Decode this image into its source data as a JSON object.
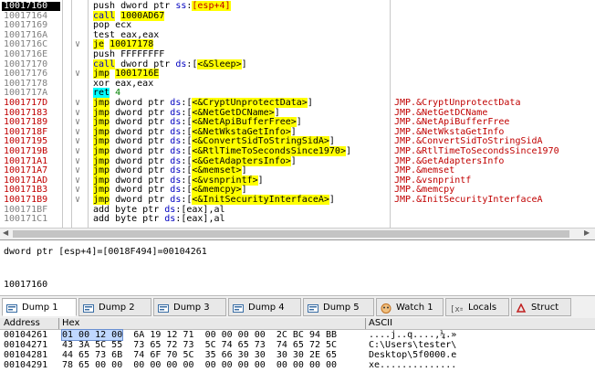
{
  "disasm": {
    "rows": [
      {
        "addr": "10017160",
        "addr_style": "sel",
        "arrow": "",
        "parts": [
          [
            "push dword ptr ",
            "n"
          ],
          [
            "ss",
            "b"
          ],
          [
            ":",
            "n"
          ],
          [
            "[esp+4]",
            "r"
          ]
        ],
        "comment": ""
      },
      {
        "addr": "10017164",
        "addr_style": "",
        "arrow": "",
        "parts": [
          [
            "call",
            "yb"
          ],
          [
            " ",
            "n"
          ],
          [
            "1000AD67",
            "y"
          ]
        ],
        "comment": ""
      },
      {
        "addr": "10017169",
        "addr_style": "",
        "arrow": "",
        "parts": [
          [
            "pop ecx",
            "n"
          ]
        ],
        "comment": ""
      },
      {
        "addr": "1001716A",
        "addr_style": "",
        "arrow": "",
        "parts": [
          [
            "test eax,eax",
            "n"
          ]
        ],
        "comment": ""
      },
      {
        "addr": "1001716C",
        "addr_style": "",
        "arrow": "∨",
        "parts": [
          [
            "je",
            "y"
          ],
          [
            " ",
            "n"
          ],
          [
            "10017178",
            "y"
          ]
        ],
        "comment": ""
      },
      {
        "addr": "1001716E",
        "addr_style": "",
        "arrow": "",
        "parts": [
          [
            "push FFFFFFFF",
            "n"
          ]
        ],
        "comment": ""
      },
      {
        "addr": "10017170",
        "addr_style": "",
        "arrow": "",
        "parts": [
          [
            "call",
            "yb"
          ],
          [
            " dword ptr ",
            "n"
          ],
          [
            "ds",
            "b"
          ],
          [
            ":[",
            "n"
          ],
          [
            "<&Sleep>",
            "y"
          ],
          [
            "]",
            "n"
          ]
        ],
        "comment": ""
      },
      {
        "addr": "10017176",
        "addr_style": "",
        "arrow": "∨",
        "parts": [
          [
            "jmp",
            "y"
          ],
          [
            " ",
            "n"
          ],
          [
            "1001716E",
            "y"
          ]
        ],
        "comment": ""
      },
      {
        "addr": "10017178",
        "addr_style": "",
        "arrow": "",
        "parts": [
          [
            "xor eax,eax",
            "n"
          ]
        ],
        "comment": ""
      },
      {
        "addr": "1001717A",
        "addr_style": "",
        "arrow": "",
        "parts": [
          [
            "ret",
            "c"
          ],
          [
            " 4",
            "g"
          ]
        ],
        "comment": ""
      },
      {
        "addr": "1001717D",
        "addr_style": "red",
        "arrow": "∨",
        "parts": [
          [
            "jmp",
            "y"
          ],
          [
            " dword ptr ",
            "n"
          ],
          [
            "ds",
            "b"
          ],
          [
            ":[",
            "n"
          ],
          [
            "<&CryptUnprotectData>",
            "y"
          ],
          [
            "]",
            "n"
          ]
        ],
        "comment": "JMP.&CryptUnprotectData"
      },
      {
        "addr": "10017183",
        "addr_style": "red",
        "arrow": "∨",
        "parts": [
          [
            "jmp",
            "y"
          ],
          [
            " dword ptr ",
            "n"
          ],
          [
            "ds",
            "b"
          ],
          [
            ":[",
            "n"
          ],
          [
            "<&NetGetDCName>",
            "y"
          ],
          [
            "]",
            "n"
          ]
        ],
        "comment": "JMP.&NetGetDCName"
      },
      {
        "addr": "10017189",
        "addr_style": "red",
        "arrow": "∨",
        "parts": [
          [
            "jmp",
            "y"
          ],
          [
            " dword ptr ",
            "n"
          ],
          [
            "ds",
            "b"
          ],
          [
            ":[",
            "n"
          ],
          [
            "<&NetApiBufferFree>",
            "y"
          ],
          [
            "]",
            "n"
          ]
        ],
        "comment": "JMP.&NetApiBufferFree"
      },
      {
        "addr": "1001718F",
        "addr_style": "red",
        "arrow": "∨",
        "parts": [
          [
            "jmp",
            "y"
          ],
          [
            " dword ptr ",
            "n"
          ],
          [
            "ds",
            "b"
          ],
          [
            ":[",
            "n"
          ],
          [
            "<&NetWkstaGetInfo>",
            "y"
          ],
          [
            "]",
            "n"
          ]
        ],
        "comment": "JMP.&NetWkstaGetInfo"
      },
      {
        "addr": "10017195",
        "addr_style": "red",
        "arrow": "∨",
        "parts": [
          [
            "jmp",
            "y"
          ],
          [
            " dword ptr ",
            "n"
          ],
          [
            "ds",
            "b"
          ],
          [
            ":[",
            "n"
          ],
          [
            "<&ConvertSidToStringSidA>",
            "y"
          ],
          [
            "]",
            "n"
          ]
        ],
        "comment": "JMP.&ConvertSidToStringSidA"
      },
      {
        "addr": "1001719B",
        "addr_style": "red",
        "arrow": "∨",
        "parts": [
          [
            "jmp",
            "y"
          ],
          [
            " dword ptr ",
            "n"
          ],
          [
            "ds",
            "b"
          ],
          [
            ":[",
            "n"
          ],
          [
            "<&RtlTimeToSecondsSince1970>",
            "y"
          ],
          [
            "]",
            "n"
          ]
        ],
        "comment": "JMP.&RtlTimeToSecondsSince1970"
      },
      {
        "addr": "100171A1",
        "addr_style": "red",
        "arrow": "∨",
        "parts": [
          [
            "jmp",
            "y"
          ],
          [
            " dword ptr ",
            "n"
          ],
          [
            "ds",
            "b"
          ],
          [
            ":[",
            "n"
          ],
          [
            "<&GetAdaptersInfo>",
            "y"
          ],
          [
            "]",
            "n"
          ]
        ],
        "comment": "JMP.&GetAdaptersInfo"
      },
      {
        "addr": "100171A7",
        "addr_style": "red",
        "arrow": "∨",
        "parts": [
          [
            "jmp",
            "y"
          ],
          [
            " dword ptr ",
            "n"
          ],
          [
            "ds",
            "b"
          ],
          [
            ":[",
            "n"
          ],
          [
            "<&memset>",
            "y"
          ],
          [
            "]",
            "n"
          ]
        ],
        "comment": "JMP.&memset"
      },
      {
        "addr": "100171AD",
        "addr_style": "red",
        "arrow": "∨",
        "parts": [
          [
            "jmp",
            "y"
          ],
          [
            " dword ptr ",
            "n"
          ],
          [
            "ds",
            "b"
          ],
          [
            ":[",
            "n"
          ],
          [
            "<&vsnprintf>",
            "y"
          ],
          [
            "]",
            "n"
          ]
        ],
        "comment": "JMP.&vsnprintf"
      },
      {
        "addr": "100171B3",
        "addr_style": "red",
        "arrow": "∨",
        "parts": [
          [
            "jmp",
            "y"
          ],
          [
            " dword ptr ",
            "n"
          ],
          [
            "ds",
            "b"
          ],
          [
            ":[",
            "n"
          ],
          [
            "<&memcpy>",
            "y"
          ],
          [
            "]",
            "n"
          ]
        ],
        "comment": "JMP.&memcpy"
      },
      {
        "addr": "100171B9",
        "addr_style": "red",
        "arrow": "∨",
        "parts": [
          [
            "jmp",
            "y"
          ],
          [
            " dword ptr ",
            "n"
          ],
          [
            "ds",
            "b"
          ],
          [
            ":[",
            "n"
          ],
          [
            "<&InitSecurityInterfaceA>",
            "y"
          ],
          [
            "]",
            "n"
          ]
        ],
        "comment": "JMP.&InitSecurityInterfaceA"
      },
      {
        "addr": "100171BF",
        "addr_style": "",
        "arrow": "",
        "parts": [
          [
            "add byte ptr ",
            "n"
          ],
          [
            "ds",
            "b"
          ],
          [
            ":[eax],al",
            "n"
          ]
        ],
        "comment": ""
      },
      {
        "addr": "100171C1",
        "addr_style": "",
        "arrow": "",
        "parts": [
          [
            "add byte ptr ",
            "n"
          ],
          [
            "ds",
            "b"
          ],
          [
            ":[eax],al",
            "n"
          ]
        ],
        "comment": ""
      }
    ]
  },
  "info": {
    "line1": "dword ptr [esp+4]=[0018F494]=00104261",
    "line2": "10017160"
  },
  "tabs": [
    {
      "label": "Dump 1",
      "icon": "dump-icon",
      "active": true
    },
    {
      "label": "Dump 2",
      "icon": "dump-icon",
      "active": false
    },
    {
      "label": "Dump 3",
      "icon": "dump-icon",
      "active": false
    },
    {
      "label": "Dump 4",
      "icon": "dump-icon",
      "active": false
    },
    {
      "label": "Dump 5",
      "icon": "dump-icon",
      "active": false
    },
    {
      "label": "Watch 1",
      "icon": "watch-icon",
      "active": false
    },
    {
      "label": "Locals",
      "icon": "locals-icon",
      "active": false
    },
    {
      "label": "Struct",
      "icon": "struct-icon",
      "active": false
    }
  ],
  "dump": {
    "headers": {
      "address": "Address",
      "hex": "Hex",
      "ascii": "ASCII"
    },
    "rows": [
      {
        "addr": "00104261",
        "hex": [
          "01 00 12 00",
          "6A 19 12 71",
          "00 00 00 00",
          "2C BC 94 BB"
        ],
        "ascii": "....j..q....,¼.»"
      },
      {
        "addr": "00104271",
        "hex": [
          "43 3A 5C 55",
          "73 65 72 73",
          "5C 74 65 73",
          "74 65 72 5C"
        ],
        "ascii": "C:\\Users\\tester\\"
      },
      {
        "addr": "00104281",
        "hex": [
          "44 65 73 6B",
          "74 6F 70 5C",
          "35 66 30 30",
          "30 30 2E 65"
        ],
        "ascii": "Desktop\\5f0000.e"
      },
      {
        "addr": "00104291",
        "hex": [
          "78 65 00 00",
          "00 00 00 00",
          "00 00 00 00",
          "00 00 00 00"
        ],
        "ascii": "xe.............."
      }
    ]
  },
  "colors": {
    "highlight": "#ffff00",
    "address_red": "#c00000",
    "segment_blue": "#0000c0"
  }
}
